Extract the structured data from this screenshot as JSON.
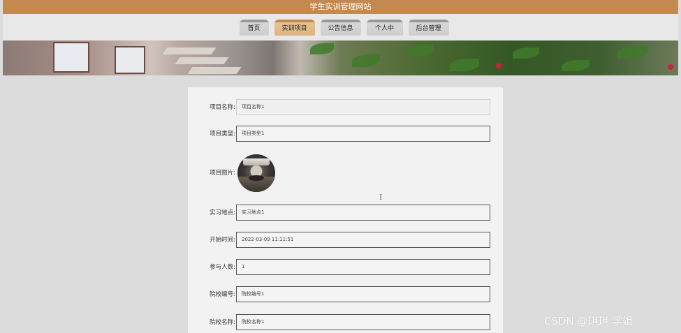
{
  "site_title": "学生实训管理网站",
  "nav": [
    {
      "label": "首页",
      "active": false
    },
    {
      "label": "实训项目",
      "active": true
    },
    {
      "label": "公告信息",
      "active": false
    },
    {
      "label": "个人中心",
      "active": false
    },
    {
      "label": "后台管理",
      "active": false
    }
  ],
  "form": {
    "project_name_label": "项目名称:",
    "project_name_value": "项目名称1",
    "project_type_label": "项目类型:",
    "project_type_value": "项目类型1",
    "project_image_label": "项目图片:",
    "location_label": "实习地点:",
    "location_value": "实习地点1",
    "start_time_label": "开始时间:",
    "start_time_value": "2022-03-09 11:11:51",
    "participants_label": "参与人数:",
    "participants_value": "1",
    "school_code_label": "院校编号:",
    "school_code_value": "院校编号1",
    "school_name_label": "院校名称:",
    "school_name_value": "院校名称1"
  },
  "watermark": "CSDN @琪琪 学姐",
  "colors": {
    "accent": "#c4894f",
    "nav_active": "#e5c192",
    "page_bg": "#dcdcdc"
  }
}
